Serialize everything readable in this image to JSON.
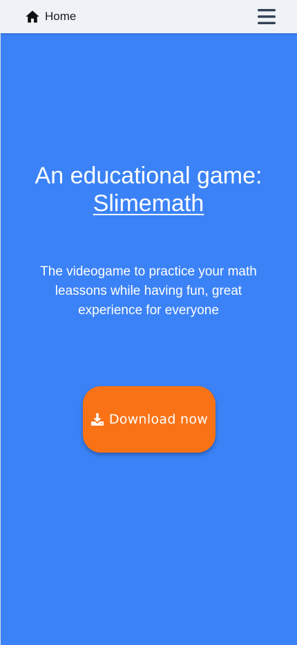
{
  "navbar": {
    "home_label": "Home",
    "home_icon": "home-icon",
    "menu_icon": "hamburger-menu-icon"
  },
  "hero": {
    "title_prefix": "An educational game:",
    "title_link": "Slimemath",
    "tagline": "The videogame to practice your math leassons while having fun, great experience for everyone",
    "download_label": "Download now",
    "download_icon": "download-icon"
  },
  "colors": {
    "navbar_bg": "#eff3f8",
    "hero_bg": "#3b82f6",
    "button_bg": "#f97316",
    "text_light": "#ffffff"
  }
}
